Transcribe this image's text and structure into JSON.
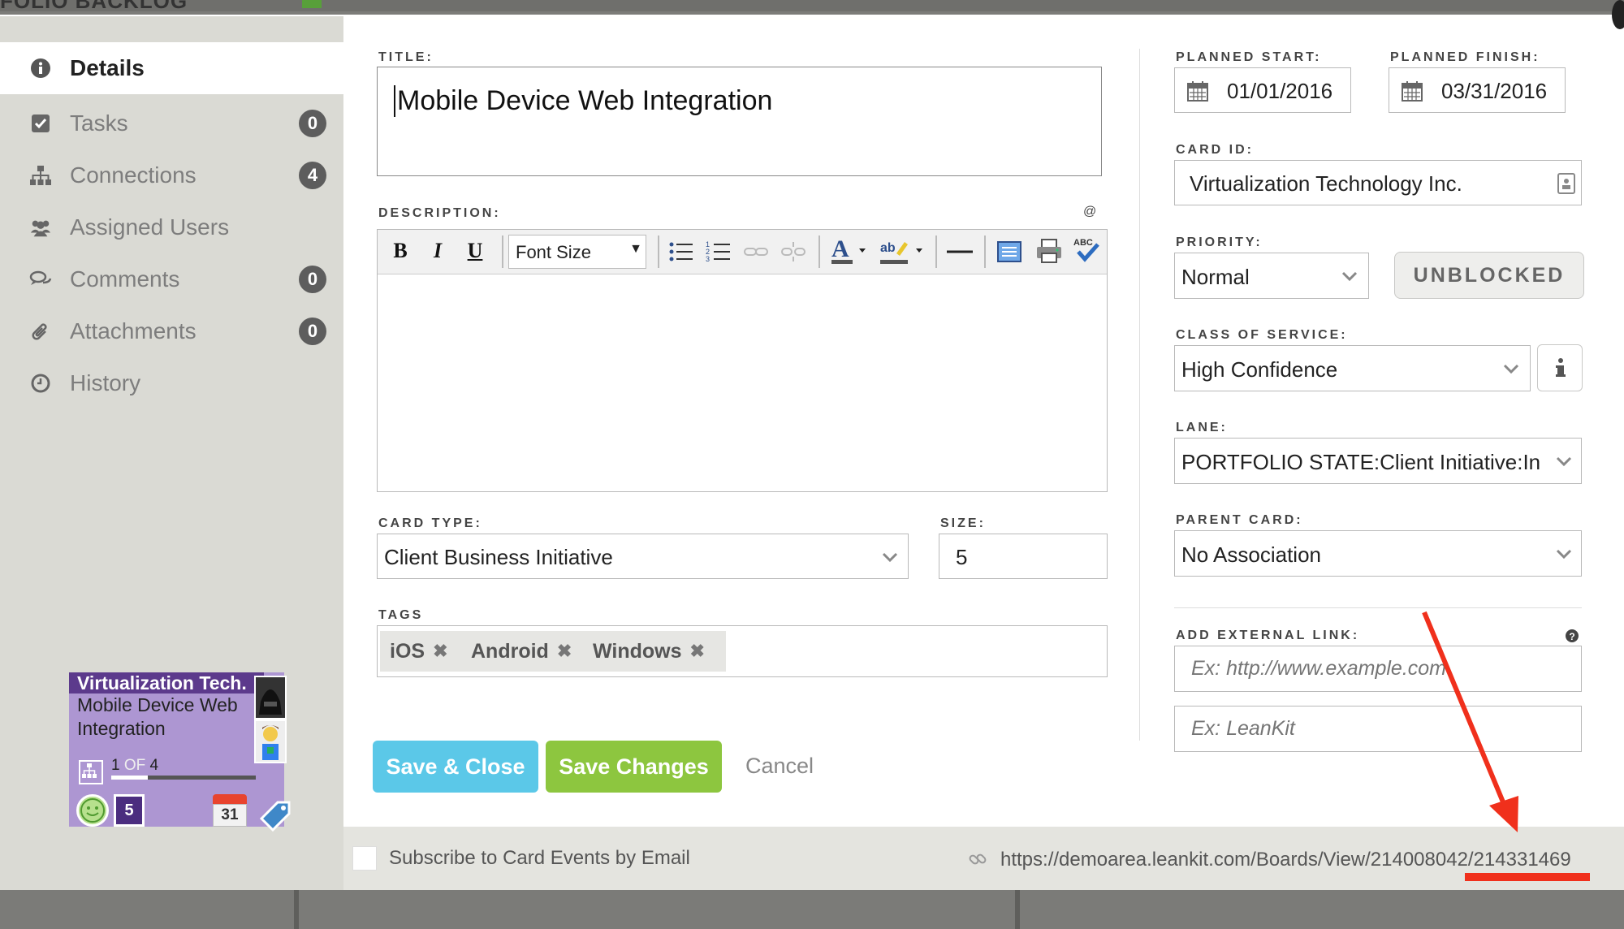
{
  "board": {
    "title": "FOLIO BACKLOG"
  },
  "sidebar": {
    "items": [
      {
        "label": "Details",
        "icon": "info-icon",
        "badge": null
      },
      {
        "label": "Tasks",
        "icon": "checkbox-icon",
        "badge": "0"
      },
      {
        "label": "Connections",
        "icon": "hierarchy-icon",
        "badge": "4"
      },
      {
        "label": "Assigned Users",
        "icon": "users-icon",
        "badge": null
      },
      {
        "label": "Comments",
        "icon": "comments-icon",
        "badge": "0"
      },
      {
        "label": "Attachments",
        "icon": "paperclip-icon",
        "badge": "0"
      },
      {
        "label": "History",
        "icon": "clock-icon",
        "badge": null
      }
    ]
  },
  "card_preview": {
    "header": "Virtualization Tech.",
    "title": "Mobile Device Web Integration",
    "progress_current": "1",
    "progress_of": "OF",
    "progress_total": "4",
    "size": "5",
    "calendar_day": "31"
  },
  "form": {
    "title_label": "TITLE:",
    "title_value": "Mobile Device Web Integration",
    "description_label": "DESCRIPTION:",
    "description_at": "@",
    "font_size_label": "Font Size",
    "card_type_label": "CARD TYPE:",
    "card_type_value": "Client Business Initiative",
    "size_label": "SIZE:",
    "size_value": "5",
    "tags_label": "TAGS",
    "tags": [
      "iOS",
      "Android",
      "Windows"
    ],
    "tag_remove": "✖"
  },
  "right": {
    "planned_start_label": "PLANNED START:",
    "planned_start_value": "01/01/2016",
    "planned_finish_label": "PLANNED FINISH:",
    "planned_finish_value": "03/31/2016",
    "card_id_label": "CARD ID:",
    "card_id_value": "Virtualization Technology Inc.",
    "priority_label": "PRIORITY:",
    "priority_value": "Normal",
    "unblocked_label": "UNBLOCKED",
    "class_of_service_label": "CLASS OF SERVICE:",
    "class_of_service_value": "High Confidence",
    "lane_label": "LANE:",
    "lane_value": "PORTFOLIO STATE:Client Initiative:In",
    "parent_card_label": "PARENT CARD:",
    "parent_card_value": "No Association",
    "external_link_label": "ADD EXTERNAL LINK:",
    "external_link_url_placeholder": "Ex: http://www.example.com",
    "external_link_name_placeholder": "Ex: LeanKit"
  },
  "actions": {
    "save_close": "Save & Close",
    "save_changes": "Save Changes",
    "cancel": "Cancel"
  },
  "footer": {
    "subscribe_label": "Subscribe to Card Events by Email",
    "card_url": "https://demoarea.leankit.com/Boards/View/214008042/214331469"
  },
  "colors": {
    "save_close": "#5bc8e8",
    "save_changes": "#8dc63f",
    "card_purple": "#ad96d2",
    "card_header": "#5c3a8c",
    "annotation_red": "#f0301c"
  }
}
